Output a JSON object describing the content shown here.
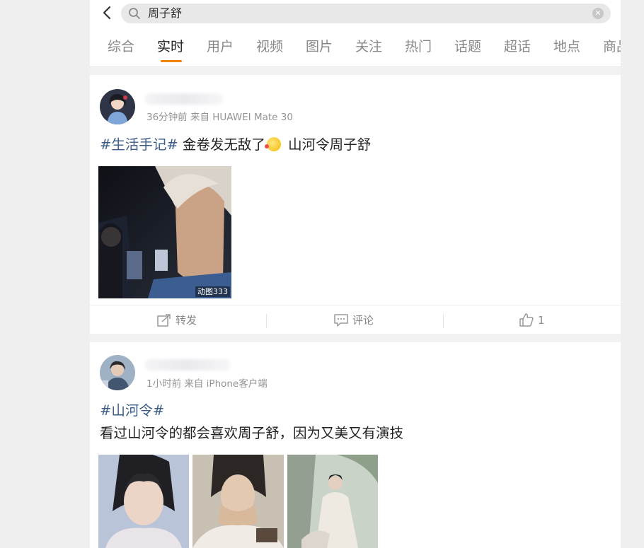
{
  "search": {
    "query": "周子舒"
  },
  "tabs": [
    {
      "label": "综合"
    },
    {
      "label": "实时"
    },
    {
      "label": "用户"
    },
    {
      "label": "视频"
    },
    {
      "label": "图片"
    },
    {
      "label": "关注"
    },
    {
      "label": "热门"
    },
    {
      "label": "话题"
    },
    {
      "label": "超话"
    },
    {
      "label": "地点"
    },
    {
      "label": "商品"
    }
  ],
  "active_tab": "实时",
  "accent_color": "#f08300",
  "hashtag_color": "#3b5c86",
  "posts": [
    {
      "meta": "36分钟前 来自 HUAWEI Mate 30",
      "hashtag": "#生活手记#",
      "text_before_emoji": " 金卷发无敌了",
      "text_after_emoji": " 山河令周子舒",
      "images": [
        {
          "badge": "动图333"
        }
      ],
      "actions": {
        "repost_label": "转发",
        "comment_label": "评论",
        "like_count": "1"
      }
    },
    {
      "meta": "1小时前 来自 iPhone客户端",
      "hashtag": "#山河令#",
      "text": "看过山河令的都会喜欢周子舒，因为又美又有演技"
    }
  ]
}
